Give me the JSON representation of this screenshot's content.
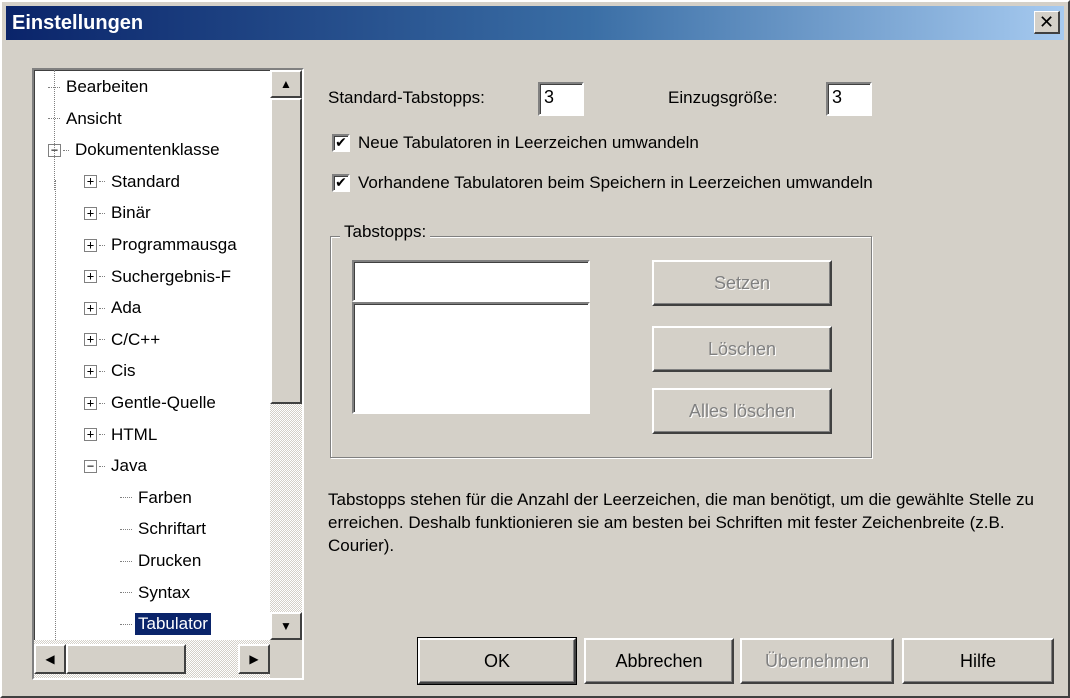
{
  "window": {
    "title": "Einstellungen",
    "close_glyph": "✕"
  },
  "tree": {
    "items": [
      {
        "label": "Bearbeiten",
        "level": 0,
        "expander": "none"
      },
      {
        "label": "Ansicht",
        "level": 0,
        "expander": "none"
      },
      {
        "label": "Dokumentenklasse",
        "level": 0,
        "expander": "minus"
      },
      {
        "label": "Standard",
        "level": 1,
        "expander": "plus"
      },
      {
        "label": "Binär",
        "level": 1,
        "expander": "plus"
      },
      {
        "label": "Programmausga",
        "level": 1,
        "expander": "plus"
      },
      {
        "label": "Suchergebnis-F",
        "level": 1,
        "expander": "plus"
      },
      {
        "label": "Ada",
        "level": 1,
        "expander": "plus"
      },
      {
        "label": "C/C++",
        "level": 1,
        "expander": "plus"
      },
      {
        "label": "Cis",
        "level": 1,
        "expander": "plus"
      },
      {
        "label": "Gentle-Quelle",
        "level": 1,
        "expander": "plus"
      },
      {
        "label": "HTML",
        "level": 1,
        "expander": "plus"
      },
      {
        "label": "Java",
        "level": 1,
        "expander": "minus"
      },
      {
        "label": "Farben",
        "level": 2,
        "expander": "none"
      },
      {
        "label": "Schriftart",
        "level": 2,
        "expander": "none"
      },
      {
        "label": "Drucken",
        "level": 2,
        "expander": "none"
      },
      {
        "label": "Syntax",
        "level": 2,
        "expander": "none"
      },
      {
        "label": "Tabulator",
        "level": 2,
        "expander": "none",
        "selected": true
      }
    ]
  },
  "settings": {
    "standard_tabstops_label": "Standard-Tabstopps:",
    "standard_tabstops_value": "3",
    "indent_size_label": "Einzugsgröße:",
    "indent_size_value": "3",
    "convert_new_tabs_label": "Neue Tabulatoren in Leerzeichen umwandeln",
    "convert_new_tabs_checked": true,
    "convert_existing_tabs_label": "Vorhandene Tabulatoren beim Speichern in Leerzeichen umwandeln",
    "convert_existing_tabs_checked": true
  },
  "tabstops_group": {
    "title": "Tabstopps:",
    "input_value": "",
    "set_button": "Setzen",
    "delete_button": "Löschen",
    "delete_all_button": "Alles löschen"
  },
  "description": "Tabstopps stehen für die Anzahl der Leerzeichen, die man benötigt, um die gewählte Stelle zu erreichen. Deshalb funktionieren sie am besten bei Schriften mit fester Zeichenbreite (z.B. Courier).",
  "footer": {
    "ok": "OK",
    "cancel": "Abbrechen",
    "apply": "Übernehmen",
    "help": "Hilfe"
  },
  "colors": {
    "title_bar_start": "#0a246a",
    "title_bar_end": "#a6caf0",
    "dialog_face": "#d4d0c8",
    "selection": "#0a246a"
  },
  "icons": {
    "checkbox_check": "✔",
    "scroll_up": "▲",
    "scroll_down": "▼",
    "scroll_left": "◀",
    "scroll_right": "▶"
  }
}
